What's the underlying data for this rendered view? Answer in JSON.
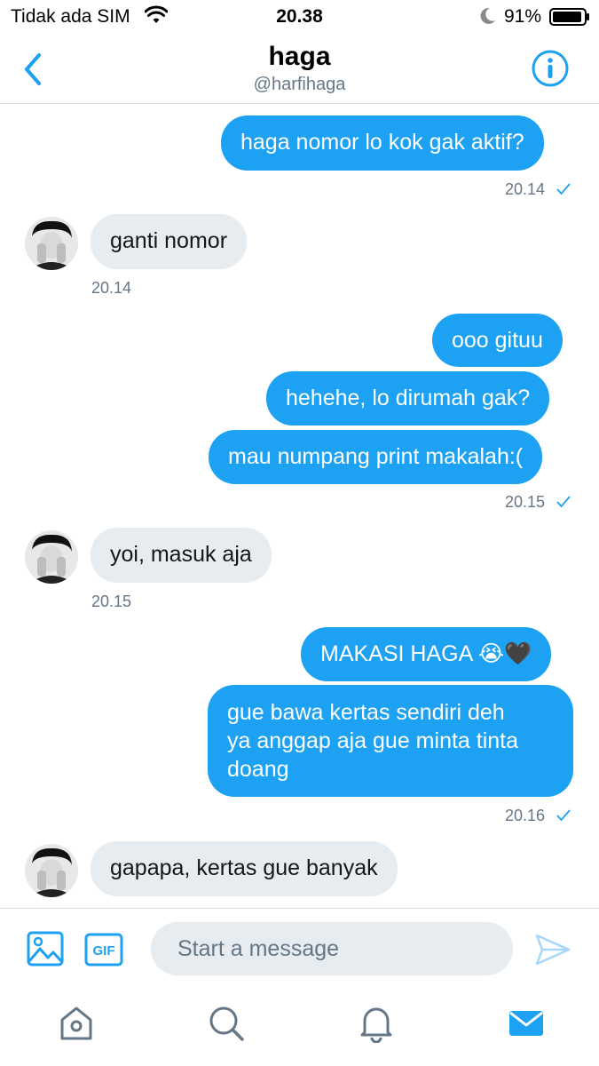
{
  "status_bar": {
    "carrier": "Tidak ada SIM",
    "time": "20.38",
    "battery": "91%",
    "icons": [
      "wifi-icon",
      "moon-icon",
      "battery-icon"
    ]
  },
  "header": {
    "name": "haga",
    "handle": "@harfihaga",
    "icons": [
      "back-chevron-icon",
      "info-icon"
    ]
  },
  "colors": {
    "accent": "#1da1f2",
    "incoming_bubble": "#e6ecf0",
    "secondary_text": "#657786"
  },
  "messages": [
    {
      "dir": "out",
      "text": "haga nomor lo kok gak aktif?"
    },
    {
      "dir": "ts_out",
      "text": "20.14"
    },
    {
      "dir": "in",
      "text": "ganti nomor"
    },
    {
      "dir": "ts_in",
      "text": "20.14"
    },
    {
      "dir": "out",
      "text": "ooo gituu"
    },
    {
      "dir": "out",
      "text": "hehehe, lo dirumah gak?"
    },
    {
      "dir": "out",
      "text": "mau numpang print makalah:("
    },
    {
      "dir": "ts_out",
      "text": "20.15"
    },
    {
      "dir": "in",
      "text": "yoi, masuk aja"
    },
    {
      "dir": "ts_in",
      "text": "20.15"
    },
    {
      "dir": "out",
      "text": "MAKASI HAGA 😭🖤"
    },
    {
      "dir": "out",
      "lines": [
        "gue bawa kertas sendiri deh",
        "ya anggap aja gue minta tinta",
        "doang"
      ]
    },
    {
      "dir": "ts_out",
      "text": "20.16"
    },
    {
      "dir": "in",
      "text": "gapapa, kertas gue banyak"
    }
  ],
  "composer": {
    "placeholder": "Start a message",
    "gif_label": "GIF",
    "icons": [
      "image-icon",
      "gif-icon",
      "send-icon"
    ]
  },
  "tabbar": {
    "items": [
      "home-icon",
      "search-icon",
      "notifications-icon",
      "messages-icon"
    ],
    "active": "messages-icon"
  }
}
